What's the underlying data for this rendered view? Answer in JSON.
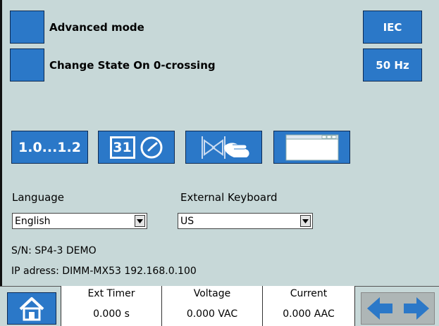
{
  "options": {
    "advanced_mode": "Advanced mode",
    "change_state": "Change State On 0-crossing"
  },
  "standard_button": "IEC",
  "frequency_button": "50 Hz",
  "toolbar": {
    "range_label": "1.0...1.2",
    "calendar_day": "31"
  },
  "language": {
    "label": "Language",
    "value": "English"
  },
  "keyboard": {
    "label": "External Keyboard",
    "value": "US"
  },
  "info": {
    "serial": "S/N: SP4-3  DEMO",
    "ip": "IP adress: DIMM-MX53 192.168.0.100"
  },
  "status": {
    "ext_timer": {
      "title": "Ext Timer",
      "value": "0.000 s"
    },
    "voltage": {
      "title": "Voltage",
      "value": "0.000 VAC"
    },
    "current": {
      "title": "Current",
      "value": "0.000 AAC"
    }
  },
  "icons": {
    "home": "home-icon",
    "clock": "clock-icon",
    "switch_touch": "switch-touch-icon",
    "window": "window-icon",
    "left": "arrow-left-icon",
    "right": "arrow-right-icon",
    "dropdown": "chevron-down-icon"
  },
  "colors": {
    "accent": "#2b78c8",
    "background": "#c7d8d8"
  }
}
